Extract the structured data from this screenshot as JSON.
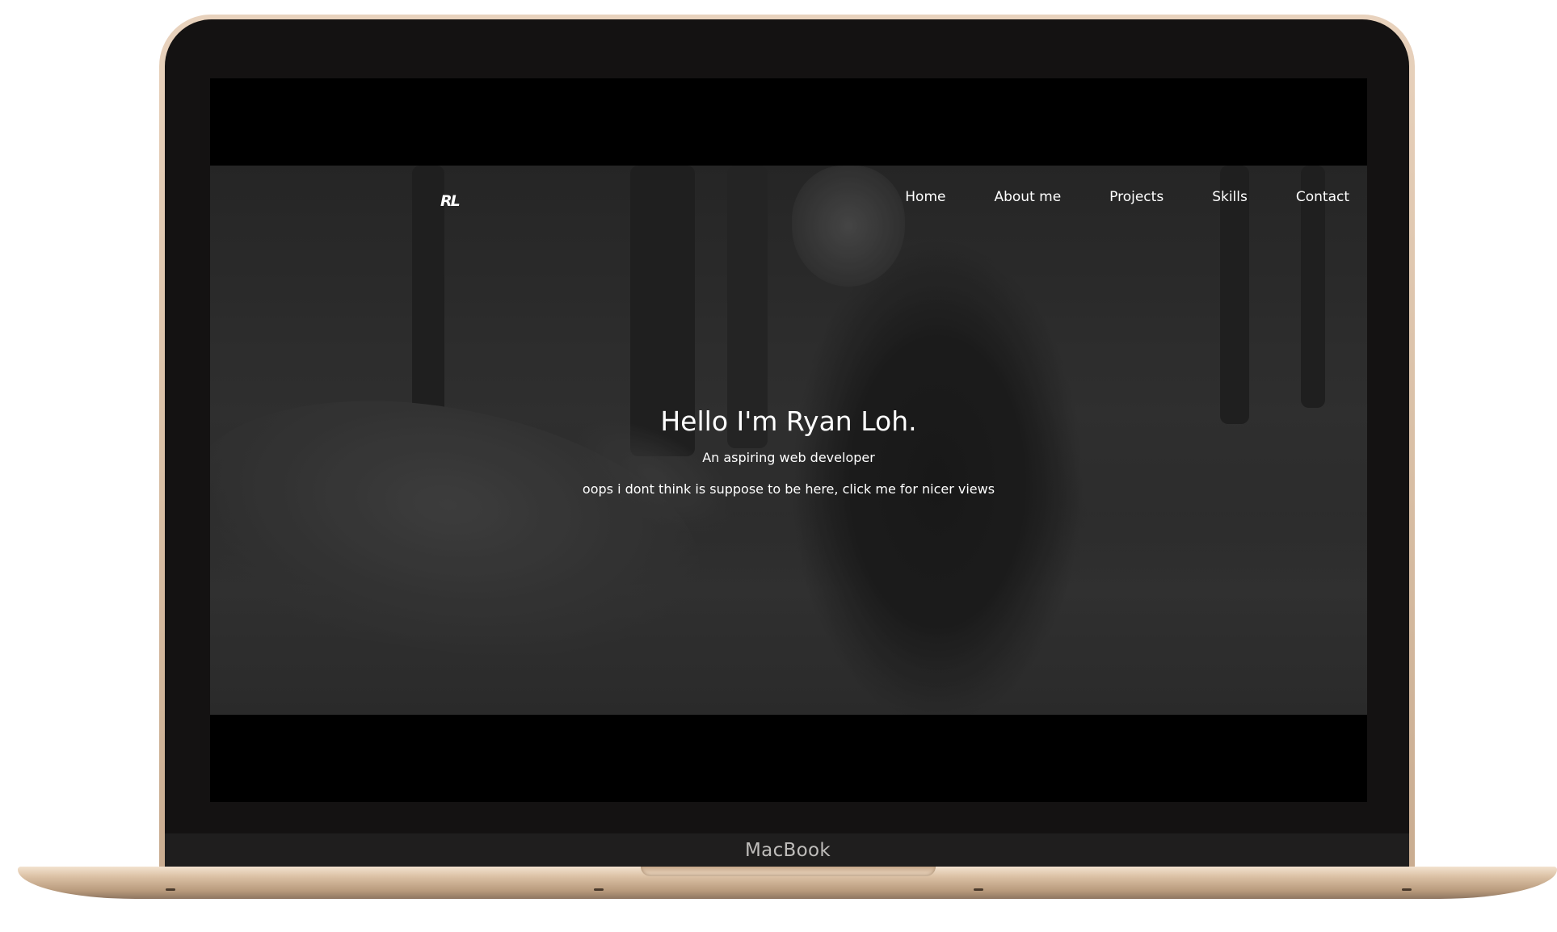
{
  "device": {
    "brand_label": "MacBook"
  },
  "site": {
    "logo": "RL",
    "nav": [
      "Home",
      "About me",
      "Projects",
      "Skills",
      "Contact"
    ],
    "hero": {
      "title": "Hello I'm Ryan Loh.",
      "subtitle": "An aspiring web developer",
      "link_text": "oops i dont think is suppose to be here, click me for nicer views"
    }
  },
  "colors": {
    "frame": "#d8bea4",
    "bezel": "#141212",
    "screen_bg": "#000000",
    "text": "#ffffff"
  }
}
